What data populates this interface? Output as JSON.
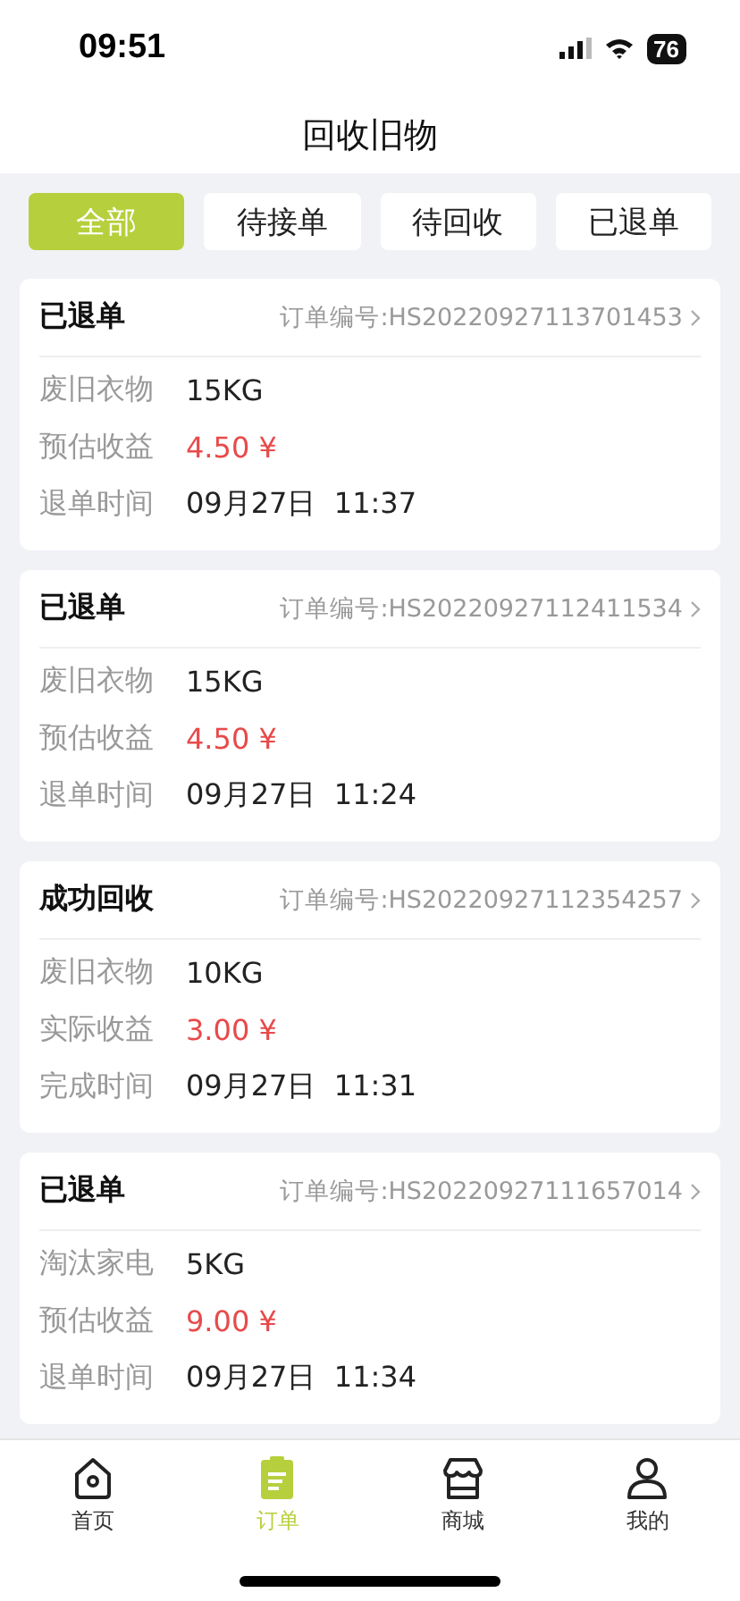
{
  "status_bar": {
    "time": "09:51",
    "battery": "76"
  },
  "title": "回收旧物",
  "filters": [
    {
      "label": "全部",
      "selected": true
    },
    {
      "label": "待接单",
      "selected": false
    },
    {
      "label": "待回收",
      "selected": false
    },
    {
      "label": "已退单",
      "selected": false
    }
  ],
  "orders": [
    {
      "status": "已退单",
      "order_no": "订单编号:HS20220927113701453",
      "rows": [
        {
          "label": "废旧衣物",
          "value": "15KG",
          "kind": "text"
        },
        {
          "label": "预估收益",
          "value": "4.50 ¥",
          "kind": "money"
        },
        {
          "label": "退单时间",
          "value": "09月27日  11:37",
          "kind": "text"
        }
      ]
    },
    {
      "status": "已退单",
      "order_no": "订单编号:HS20220927112411534",
      "rows": [
        {
          "label": "废旧衣物",
          "value": "15KG",
          "kind": "text"
        },
        {
          "label": "预估收益",
          "value": "4.50 ¥",
          "kind": "money"
        },
        {
          "label": "退单时间",
          "value": "09月27日  11:24",
          "kind": "text"
        }
      ]
    },
    {
      "status": "成功回收",
      "order_no": "订单编号:HS20220927112354257",
      "rows": [
        {
          "label": "废旧衣物",
          "value": "10KG",
          "kind": "text"
        },
        {
          "label": "实际收益",
          "value": "3.00 ¥",
          "kind": "money"
        },
        {
          "label": "完成时间",
          "value": "09月27日  11:31",
          "kind": "text"
        }
      ]
    },
    {
      "status": "已退单",
      "order_no": "订单编号:HS20220927111657014",
      "rows": [
        {
          "label": "淘汰家电",
          "value": "5KG",
          "kind": "text"
        },
        {
          "label": "预估收益",
          "value": "9.00 ¥",
          "kind": "money"
        },
        {
          "label": "退单时间",
          "value": "09月27日  11:34",
          "kind": "text"
        }
      ]
    }
  ],
  "tab_bar": [
    {
      "label": "首页",
      "kind": "home",
      "selected": false
    },
    {
      "label": "订单",
      "kind": "orders",
      "selected": true
    },
    {
      "label": "商城",
      "kind": "shop",
      "selected": false
    },
    {
      "label": "我的",
      "kind": "profile",
      "selected": false
    }
  ]
}
